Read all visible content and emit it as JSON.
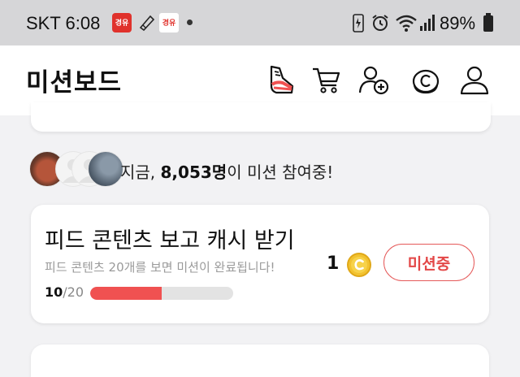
{
  "status_bar": {
    "carrier_time": "SKT 6:08",
    "app_badge_1": "경유",
    "app_badge_2": "경유",
    "battery": "89%",
    "icons": [
      "battery-saver-icon",
      "alarm-icon",
      "wifi-icon",
      "signal-icon",
      "battery-icon"
    ]
  },
  "header": {
    "title": "미션보드",
    "icons": [
      "sneaker-icon",
      "cart-icon",
      "add-friend-icon",
      "coin-icon",
      "profile-icon"
    ]
  },
  "participants": {
    "prefix": "지금, ",
    "count": "8,053명",
    "suffix": "이 미션 참여중!"
  },
  "mission": {
    "title": "피드 콘텐츠 보고 캐시 받기",
    "description": "피드 콘텐츠 20개를 보면 미션이 완료됩니다!",
    "reward": "1",
    "button_label": "미션중",
    "progress_current": "10",
    "progress_total": "/20",
    "progress_fraction": 0.5
  },
  "colors": {
    "accent": "#e34747",
    "progress_fill": "#f05151",
    "coin": "#f2c230"
  }
}
